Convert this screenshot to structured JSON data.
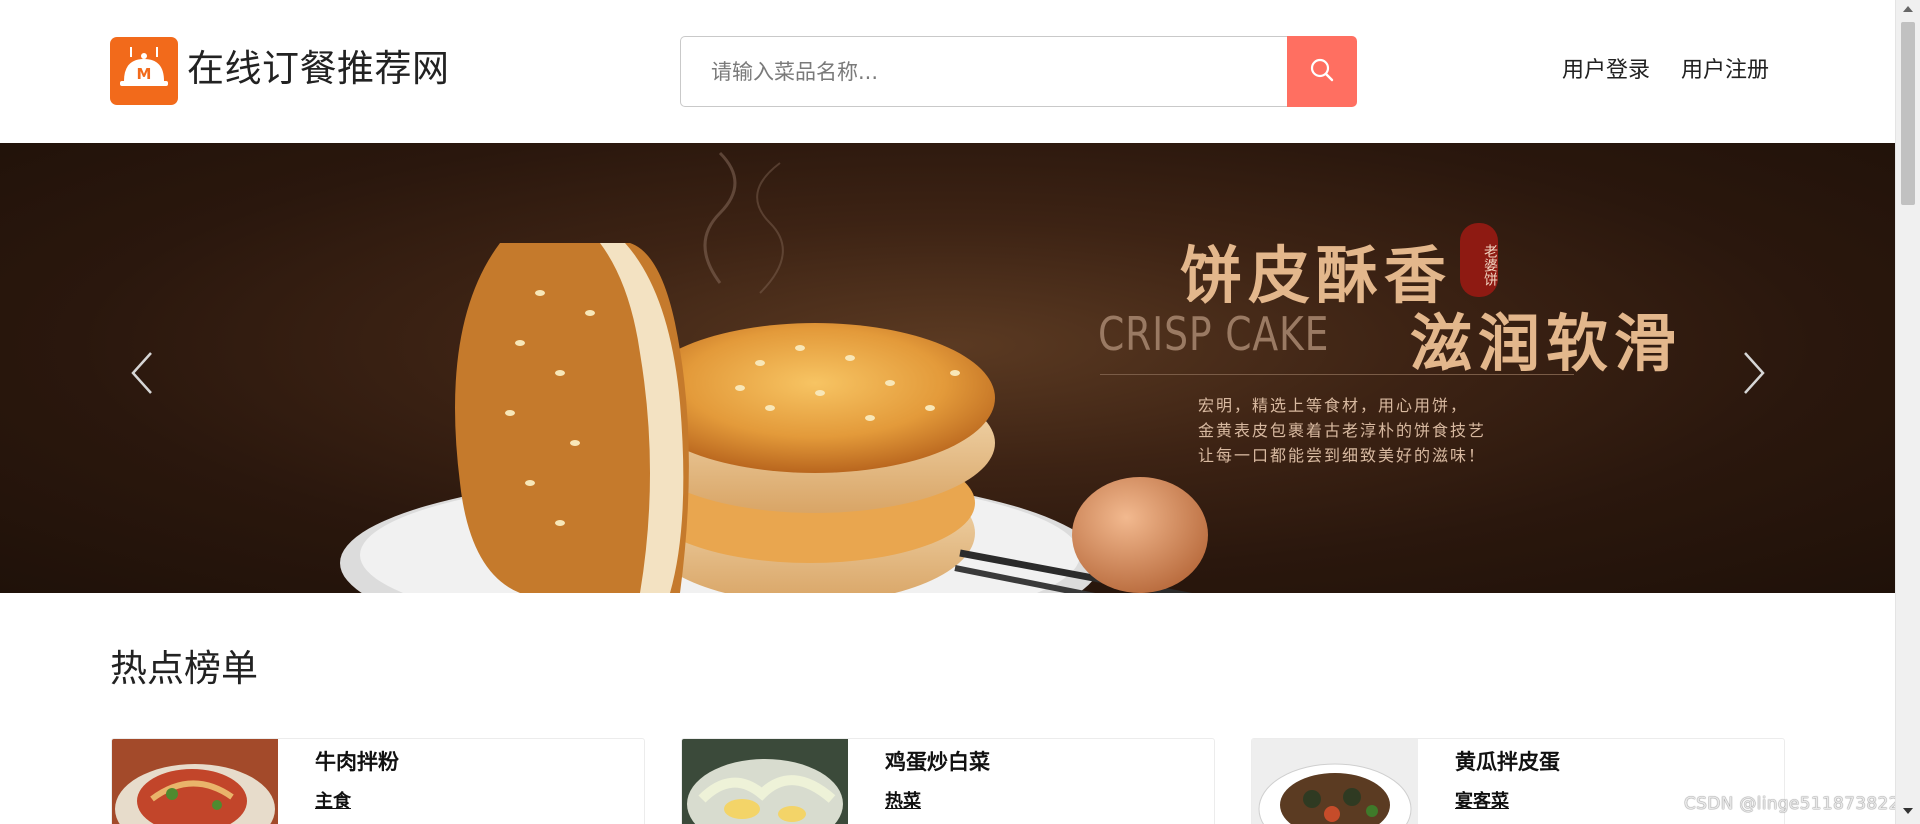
{
  "header": {
    "site_title": "在线订餐推荐网",
    "search": {
      "placeholder": "请输入菜品名称...",
      "value": ""
    },
    "nav": {
      "login": "用户登录",
      "register": "用户注册"
    }
  },
  "banner": {
    "heading_line1": "饼皮酥香",
    "heading_line2": "滋润软滑",
    "english": "CRISP CAKE",
    "seal": "老婆饼",
    "description": [
      "宏明，精选上等食材，用心用饼，",
      "金黄表皮包裹着古老淳朴的饼食技艺",
      "让每一口都能尝到细致美好的滋味！"
    ]
  },
  "hot_list": {
    "title": "热点榜单",
    "items": [
      {
        "name": "牛肉拌粉",
        "category": "主食"
      },
      {
        "name": "鸡蛋炒白菜",
        "category": "热菜"
      },
      {
        "name": "黄瓜拌皮蛋",
        "category": "宴客菜"
      }
    ]
  },
  "watermark": "CSDN @linge511873822",
  "colors": {
    "logo": "#f26a1b",
    "search_button": "#ff6f61",
    "banner_text": "#e3b78c"
  }
}
